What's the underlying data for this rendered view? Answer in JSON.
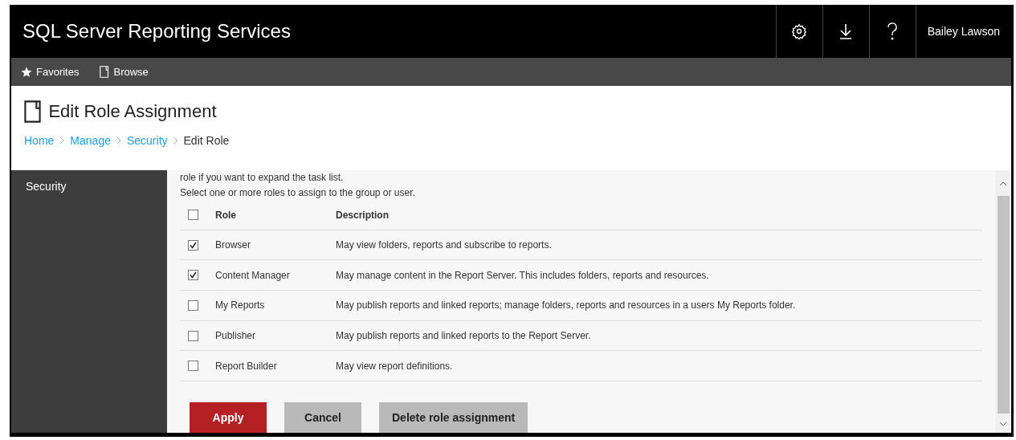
{
  "header": {
    "title": "SQL Server Reporting Services",
    "user": "Bailey Lawson"
  },
  "nav": [
    {
      "label": "Favorites"
    },
    {
      "label": "Browse"
    }
  ],
  "page": {
    "title": "Edit Role Assignment",
    "breadcrumb": [
      {
        "label": "Home",
        "link": true
      },
      {
        "label": "Manage",
        "link": true
      },
      {
        "label": "Security",
        "link": true
      },
      {
        "label": "Edit Role",
        "link": false
      }
    ]
  },
  "sidebar": {
    "items": [
      {
        "label": "Security"
      }
    ]
  },
  "intro": [
    "role if you want to expand the task list.",
    "Select one or more roles to assign to the group or user."
  ],
  "table": {
    "header_checked": false,
    "columns": [
      "Role",
      "Description"
    ],
    "rows": [
      {
        "role": "Browser",
        "description": "May view folders, reports and subscribe to reports.",
        "checked": true
      },
      {
        "role": "Content Manager",
        "description": "May manage content in the Report Server. This includes folders, reports and resources.",
        "checked": true
      },
      {
        "role": "My Reports",
        "description": "May publish reports and linked reports; manage folders, reports and resources in a users My Reports folder.",
        "checked": false
      },
      {
        "role": "Publisher",
        "description": "May publish reports and linked reports to the Report Server.",
        "checked": false
      },
      {
        "role": "Report Builder",
        "description": "May view report definitions.",
        "checked": false
      }
    ]
  },
  "buttons": [
    {
      "label": "Apply",
      "kind": "primary"
    },
    {
      "label": "Cancel",
      "kind": "secondary"
    },
    {
      "label": "Delete role assignment",
      "kind": "secondary"
    }
  ]
}
